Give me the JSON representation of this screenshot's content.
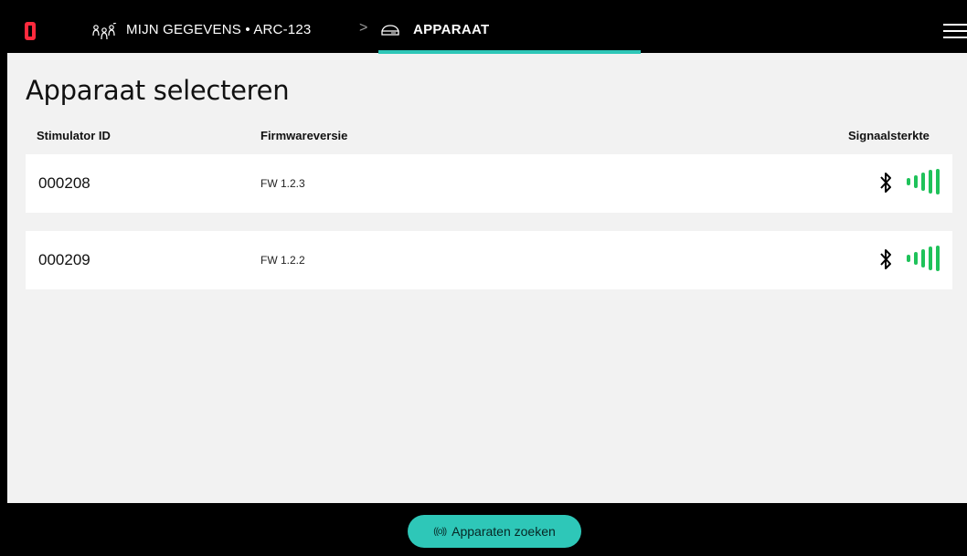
{
  "header": {
    "patient_label": "MIJN GEGEVENS • ARC-123",
    "separator": ">",
    "device_label": "APPARAAT",
    "accent_color": "#2ec7b8",
    "logo_color": "#ff2a3d"
  },
  "page": {
    "title": "Apparaat selecteren"
  },
  "table": {
    "headers": [
      "Stimulator ID",
      "Firmwareversie",
      "Signaalsterkte"
    ],
    "rows": [
      {
        "id": "000208",
        "firmware": "FW 1.2.3",
        "signal_icon": "bluetooth-icon",
        "signal_level": 1.0
      },
      {
        "id": "000209",
        "firmware": "FW 1.2.2",
        "signal_icon": "bluetooth-icon",
        "signal_level": 1.0
      }
    ]
  },
  "footer": {
    "search_label": "Apparaten zoeken",
    "search_icon": "broadcast-icon"
  },
  "colors": {
    "signal_green": "#1fc25a",
    "background": "#f2f2f2"
  }
}
